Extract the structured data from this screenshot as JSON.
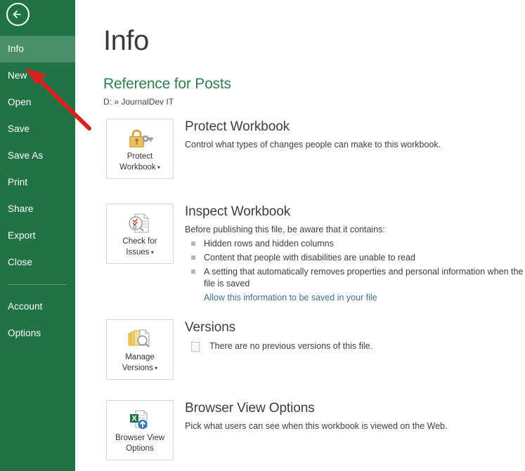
{
  "sidebar": {
    "back_icon": "back-arrow-icon",
    "items": [
      {
        "label": "Info",
        "selected": true
      },
      {
        "label": "New",
        "selected": false
      },
      {
        "label": "Open",
        "selected": false
      },
      {
        "label": "Save",
        "selected": false
      },
      {
        "label": "Save As",
        "selected": false
      },
      {
        "label": "Print",
        "selected": false
      },
      {
        "label": "Share",
        "selected": false
      },
      {
        "label": "Export",
        "selected": false
      },
      {
        "label": "Close",
        "selected": false
      }
    ],
    "footer_items": [
      {
        "label": "Account"
      },
      {
        "label": "Options"
      }
    ]
  },
  "main": {
    "page_title": "Info",
    "document_title": "Reference for Posts",
    "document_path": "D: » JournalDev IT",
    "sections": {
      "protect": {
        "button_label_line1": "Protect",
        "button_label_line2": "Workbook",
        "button_icon": "padlock-key-icon",
        "heading": "Protect Workbook",
        "description": "Control what types of changes people can make to this workbook."
      },
      "inspect": {
        "button_label_line1": "Check for",
        "button_label_line2": "Issues",
        "button_icon": "document-inspect-icon",
        "heading": "Inspect Workbook",
        "description": "Before publishing this file, be aware that it contains:",
        "bullets": [
          "Hidden rows and hidden columns",
          "Content that people with disabilities are unable to read",
          "A setting that automatically removes properties and personal information when the file is saved"
        ],
        "link": "Allow this information to be saved in your file"
      },
      "versions": {
        "button_label_line1": "Manage",
        "button_label_line2": "Versions",
        "button_icon": "manage-versions-icon",
        "heading": "Versions",
        "note_icon": "page-outline-icon",
        "note": "There are no previous versions of this file."
      },
      "browser": {
        "button_label_line1": "Browser View",
        "button_label_line2": "Options",
        "button_icon": "excel-upload-icon",
        "heading": "Browser View Options",
        "description": "Pick what users can see when this workbook is viewed on the Web."
      }
    }
  },
  "annotation": {
    "type": "red-arrow",
    "points_to": "New",
    "color": "#d8221f"
  },
  "colors": {
    "sidebar_green": "#217346",
    "sidebar_selected_green": "#4b8f69",
    "heading_green": "#2f7d51",
    "link_blue": "#3f6f91",
    "annotation_red": "#d8221f"
  }
}
